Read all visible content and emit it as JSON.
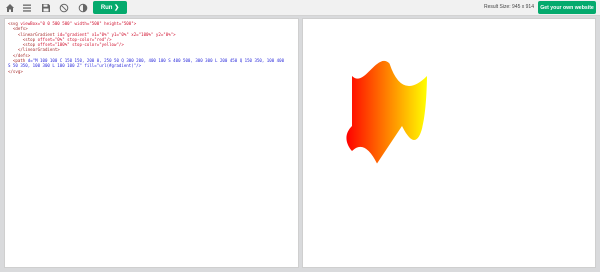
{
  "toolbar": {
    "icons": [
      "home-icon",
      "menu-icon",
      "save-icon",
      "theme-icon",
      "contrast-icon"
    ],
    "run_label": "Run ❯",
    "result_size": "Result Size: 945 x 914",
    "website_label": "Get your own website"
  },
  "code": {
    "line1_tag": "<svg",
    "line1_attrs": " viewBox=\"0 0 500 500\" width=\"500\" height=\"500\">",
    "line2": "  <defs>",
    "line3_tag": "    <linearGradient",
    "line3_attrs": " id=\"gradient\" x1=\"0%\" y1=\"0%\" x2=\"100%\" y2=\"0%\">",
    "line4_tag": "      <stop",
    "line4_attrs": " offset=\"0%\" stop-color=\"red\"/>",
    "line5_tag": "      <stop",
    "line5_attrs": " offset=\"100%\" stop-color=\"yellow\"/>",
    "line6": "    </linearGradient>",
    "line7": "  </defs>",
    "line8_tag": "  <path",
    "line8_attrs": " d=\"M 100 100 C 150 150, 200 0, 250 50 Q 300 200, 400 100 S 400 500, 300 300 L 200 450 Q 150 350, 100 400",
    "line9": "S 50 350, 100 300 L 100 100 Z\" fill=\"url(#gradient)\"/>",
    "line10": "</svg>"
  },
  "result": {
    "gradient_start": "red",
    "gradient_end": "yellow"
  }
}
